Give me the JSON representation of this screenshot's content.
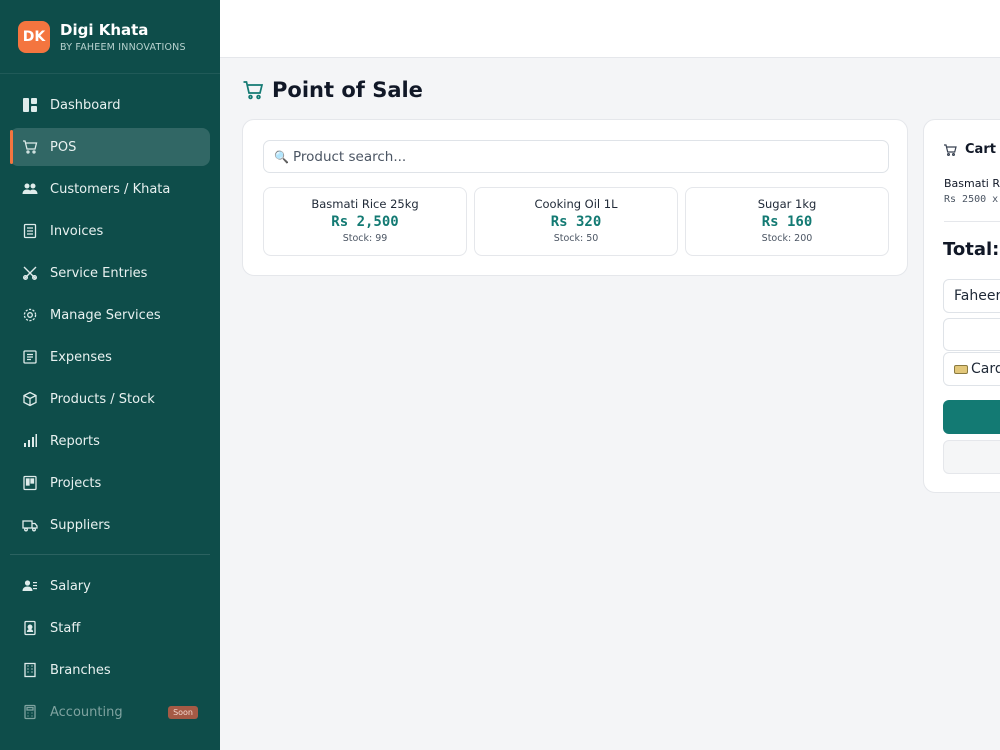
{
  "brand": {
    "initials": "DK",
    "name": "Digi Khata",
    "subtitle": "BY FAHEEM INNOVATIONS"
  },
  "sidebar": {
    "items": [
      {
        "label": "Dashboard",
        "icon": "dashboard-icon"
      },
      {
        "label": "POS",
        "icon": "cart-icon",
        "active": true
      },
      {
        "label": "Customers / Khata",
        "icon": "users-icon"
      },
      {
        "label": "Invoices",
        "icon": "invoice-icon"
      },
      {
        "label": "Service Entries",
        "icon": "tools-icon"
      },
      {
        "label": "Manage Services",
        "icon": "gear-icon"
      },
      {
        "label": "Expenses",
        "icon": "expenses-icon"
      },
      {
        "label": "Products / Stock",
        "icon": "box-icon"
      },
      {
        "label": "Reports",
        "icon": "bar-chart-icon"
      },
      {
        "label": "Projects",
        "icon": "projects-icon"
      },
      {
        "label": "Suppliers",
        "icon": "truck-icon"
      }
    ],
    "items2": [
      {
        "label": "Salary",
        "icon": "salary-icon"
      },
      {
        "label": "Staff",
        "icon": "staff-badge-icon"
      },
      {
        "label": "Branches",
        "icon": "building-icon"
      },
      {
        "label": "Accounting",
        "icon": "calculator-icon",
        "badge": "Soon",
        "disabled": true
      }
    ]
  },
  "page": {
    "title": "Point of Sale",
    "icon": "cart-icon"
  },
  "search": {
    "icon": "magnifier-icon",
    "placeholder": "Product search..."
  },
  "products": [
    {
      "name": "Basmati Rice 25kg",
      "price": "Rs 2,500",
      "stock": "Stock: 99"
    },
    {
      "name": "Cooking Oil 1L",
      "price": "Rs 320",
      "stock": "Stock: 50"
    },
    {
      "name": "Sugar 1kg",
      "price": "Rs 160",
      "stock": "Stock: 200"
    }
  ],
  "cart": {
    "title": "Cart",
    "item_name": "Basmati Ri",
    "item_line": "Rs 2500 x",
    "total_label": "Total:",
    "customer_value": "Faheer",
    "payment_value": "Card",
    "colors": {
      "accent": "#137a73",
      "sidebar": "#0e4d4a",
      "brand": "#f4753f"
    }
  }
}
